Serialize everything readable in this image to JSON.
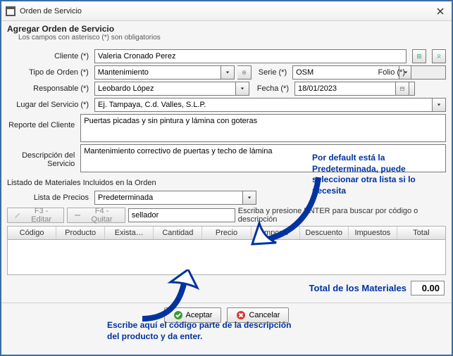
{
  "titlebar": {
    "title": "Orden de Servicio"
  },
  "header": {
    "subtitle": "Agregar Orden de Servicio",
    "hint": "Los campos con asterisco (*) son obligatorios"
  },
  "labels": {
    "cliente": "Cliente (*)",
    "tipo": "Tipo de Orden (*)",
    "serie": "Serie (*)",
    "folio": "Folio (*)",
    "responsable": "Responsable (*)",
    "fecha": "Fecha (*)",
    "lugar": "Lugar del Servicio (*)",
    "reporte": "Reporte del Cliente",
    "descripcion": "Descripción del Servicio",
    "listado": "Listado de Materiales Incluidos en la Orden",
    "lista_precios": "Lista de Precios"
  },
  "values": {
    "cliente": "Valeria Cronado Perez",
    "tipo": "Mantenimiento",
    "serie": "OSM",
    "folio": "",
    "responsable": "Leobardo López",
    "fecha": "18/01/2023",
    "lugar": "Ej. Tampaya, C.d. Valles, S.L.P.",
    "reporte": "Puertas picadas y sin pintura y lámina con goteras",
    "descripcion": "Mantenimiento correctivo de puertas y techo de lámina",
    "lista_precios": "Predeterminada",
    "search": "sellador"
  },
  "toolbar": {
    "edit": "F3 - Editar",
    "remove": "F4 - Quitar",
    "search_hint": "Escriba y presione ENTER para buscar por código o descripción"
  },
  "grid": {
    "cols": [
      "Código",
      "Producto",
      "Exista…",
      "Cantidad",
      "Precio",
      "Importe",
      "Descuento",
      "Impuestos",
      "Total"
    ]
  },
  "totals": {
    "label": "Total de los Materiales",
    "value": "0.00"
  },
  "buttons": {
    "ok": "Aceptar",
    "cancel": "Cancelar"
  },
  "callouts": {
    "a": "Por default está la Predeterminada, puede seleccionar otra lista si lo necesita",
    "b": "Escribe aquí el código parte de la descripción del producto y da enter."
  }
}
